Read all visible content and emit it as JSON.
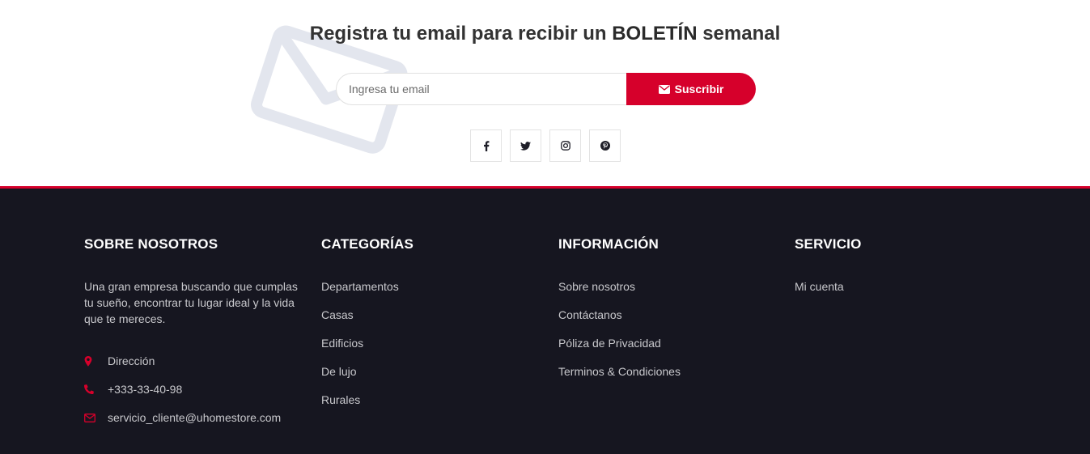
{
  "newsletter": {
    "title_prefix": "Registra tu email para recibir un",
    "title_bold": "BOLETÍN",
    "title_suffix": "semanal",
    "email_placeholder": "Ingresa tu email",
    "subscribe_label": "Suscribir",
    "subscribe_icon": "envelope-icon",
    "background_icon": "envelope-outline-icon"
  },
  "social": [
    {
      "name": "facebook",
      "icon": "facebook-icon"
    },
    {
      "name": "twitter",
      "icon": "twitter-icon"
    },
    {
      "name": "instagram",
      "icon": "instagram-icon"
    },
    {
      "name": "pinterest",
      "icon": "pinterest-icon"
    }
  ],
  "footer": {
    "about": {
      "title": "SOBRE NOSOTROS",
      "text": "Una gran empresa buscando que cumplas tu sueño, encontrar tu lugar ideal y la vida que te mereces.",
      "address": "Dirección",
      "phone": "+333-33-40-98",
      "email": "servicio_cliente@uhomestore.com"
    },
    "categories": {
      "title": "CATEGORÍAS",
      "items": [
        "Departamentos",
        "Casas",
        "Edificios",
        "De lujo",
        "Rurales"
      ]
    },
    "information": {
      "title": "INFORMACIÓN",
      "items": [
        "Sobre nosotros",
        "Contáctanos",
        "Póliza de Privacidad",
        "Terminos & Condiciones"
      ]
    },
    "service": {
      "title": "SERVICIO",
      "items": [
        "Mi cuenta"
      ]
    }
  },
  "colors": {
    "accent": "#d6002b",
    "footer_bg": "#161620",
    "text_light": "#c8c8cc",
    "envelope_bg": "#e3e6ee"
  }
}
